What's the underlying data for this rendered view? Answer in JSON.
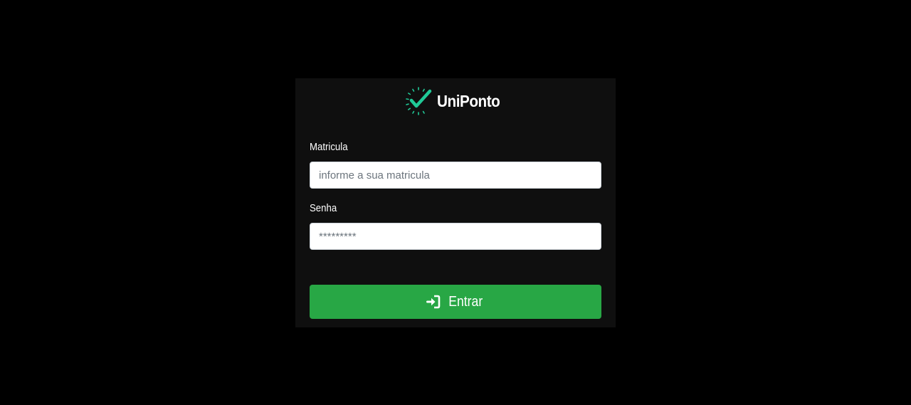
{
  "brand": {
    "name": "UniPonto",
    "logo_icon": "clock-check-icon",
    "accent_color": "#20c997"
  },
  "form": {
    "matricula": {
      "label": "Matricula",
      "placeholder": "informe a sua matricula",
      "value": ""
    },
    "senha": {
      "label": "Senha",
      "placeholder": "*********",
      "value": ""
    },
    "submit": {
      "label": "Entrar",
      "icon": "sign-in-icon",
      "color": "#28a745"
    }
  }
}
